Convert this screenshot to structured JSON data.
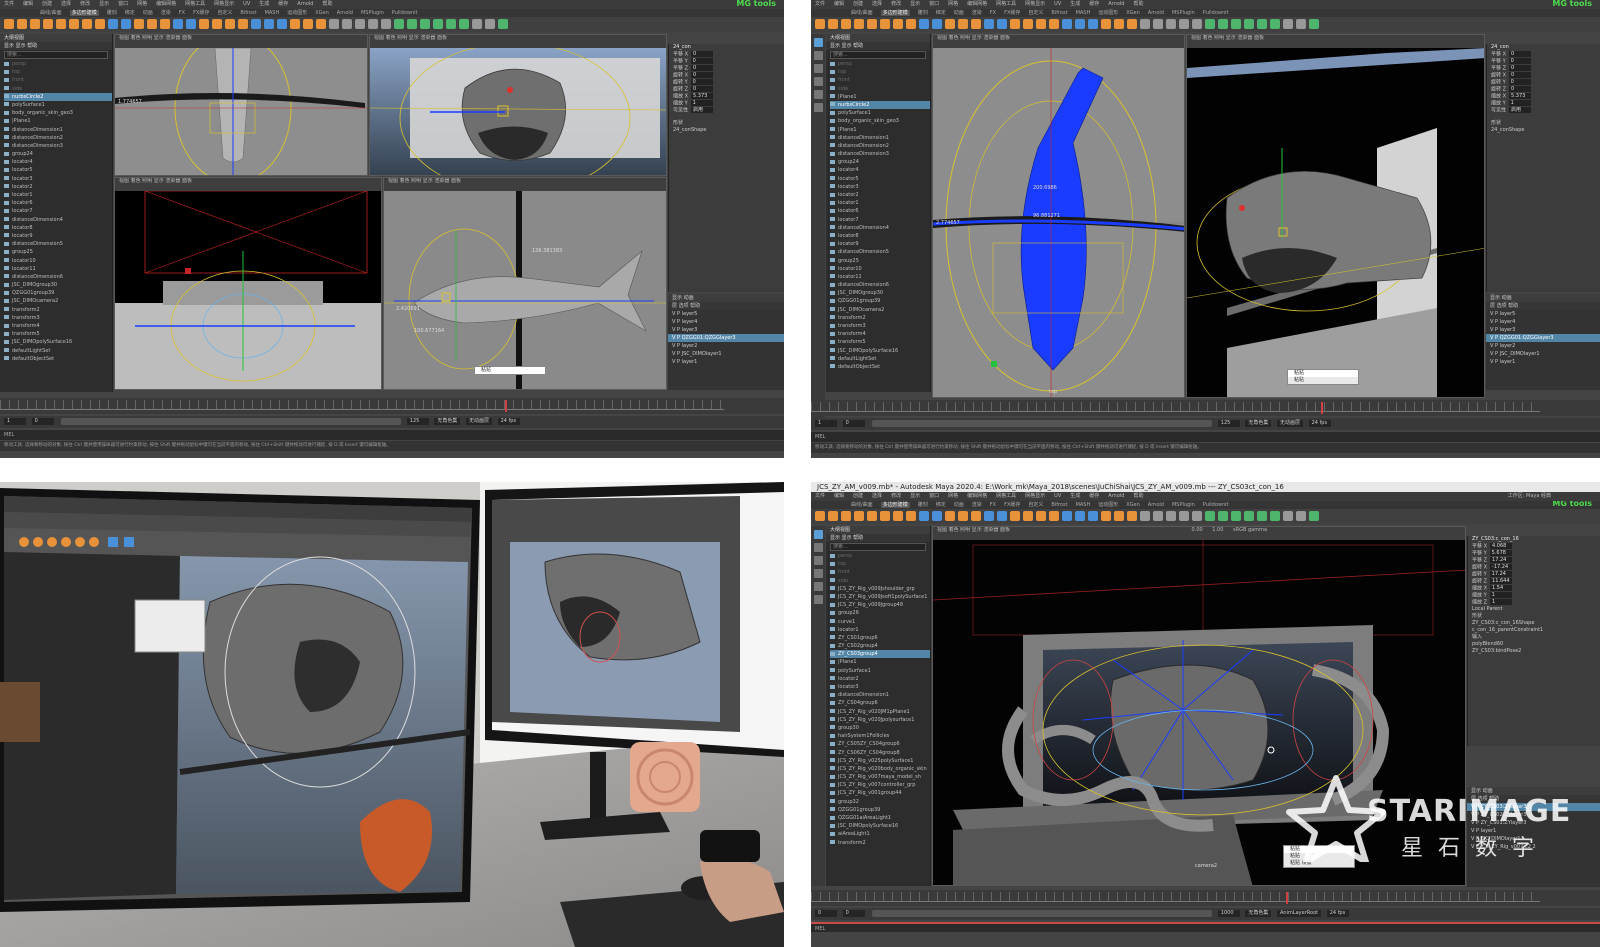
{
  "common": {
    "menu": [
      "文件",
      "编辑",
      "创建",
      "选择",
      "修改",
      "显示",
      "窗口",
      "网格",
      "编辑网格",
      "网格工具",
      "网格显示",
      "UV",
      "生成",
      "缓存",
      "Arnold",
      "帮助"
    ],
    "shelf_tabs": [
      "曲线/曲面",
      "多边形建模",
      "雕刻",
      "绑定",
      "动画",
      "渲染",
      "FX",
      "FX缓存",
      "自定义",
      "Bifrost",
      "MASH",
      "运动图形",
      "XGen",
      "Arnold",
      "MSPlugin",
      "Pulldownit"
    ],
    "shelf_active": "多边形建模",
    "mg_tools": "MG tools",
    "viewport_menu": "视图  着色  照明  显示  渲染器  面板",
    "outliner_title": "大纲视图",
    "outliner_menu": "显示  显示  帮助",
    "search_placeholder": "搜索...",
    "layers_tabs": "显示  动画",
    "layers_menu": "层  选项  帮助",
    "range_start": "0",
    "range_end": "125",
    "fps": "24 fps",
    "no_char": "无角色集",
    "no_anim": "无动画层",
    "mel": "MEL",
    "help_text": "移动工具: 选择要移动的对象, 按住 Ctrl 键并使用操纵器可进行约束移动, 按住 Shift 键并拖动鼠标中键可在当前平面内移动, 按住 Ctrl+Shift 键并拖动可进行捕捉, 按 D 或 Insert 键可编辑枢轴。",
    "popup_items": [
      "粘贴",
      "粘贴",
      "粘贴 设置"
    ]
  },
  "q1": {
    "channel_title": "24_con",
    "channels": [
      {
        "label": "平移 X",
        "value": "0"
      },
      {
        "label": "平移 Y",
        "value": "0"
      },
      {
        "label": "平移 Z",
        "value": "0"
      },
      {
        "label": "旋转 X",
        "value": "0"
      },
      {
        "label": "旋转 Y",
        "value": "0"
      },
      {
        "label": "旋转 Z",
        "value": "0"
      },
      {
        "label": "缩放 X",
        "value": "5.373"
      },
      {
        "label": "缩放 Y",
        "value": "1"
      },
      {
        "label": "可见性",
        "value": "启用"
      }
    ],
    "shape_label": "形状",
    "shape_name": "24_conShape",
    "outliner_items": [
      "persp",
      "top",
      "front",
      "side",
      "nurbsCircle2",
      "polySurface1",
      "body_organic_skin_geo3",
      "|Plane1",
      "distanceDimension1",
      "distanceDimension2",
      "distanceDimension3",
      "group24",
      "locator4",
      "locator5",
      "locator3",
      "locator2",
      "locator1",
      "locator6",
      "locator7",
      "distanceDimension4",
      "locator8",
      "locator9",
      "distanceDimension5",
      "group25",
      "locator10",
      "locator11",
      "distanceDimension6",
      "JSC_DIMOgroup30",
      "QZGG01group39",
      "JSC_DIMOcamera2",
      "transform2",
      "transform3",
      "transform4",
      "transform5",
      "JSC_DIMOpolySurface16",
      "defaultLightSet",
      "defaultObjectSet"
    ],
    "outliner_selected": 4,
    "layers": [
      "layer5",
      "layer4",
      "layer3",
      "QZGG01:QZGGlayer3",
      "layer2",
      "JSC_DIMOlayer1",
      "layer1"
    ],
    "layer_selected": 3,
    "measure_1": "136.381383",
    "measure_2": "100.677164",
    "measure_3": "2.420691",
    "measure_4": "1.774657",
    "current_frame": "97",
    "start_frame": "1",
    "end_frame": "125"
  },
  "q2": {
    "channel_title": "24_con",
    "channels": [
      {
        "label": "平移 X",
        "value": "0"
      },
      {
        "label": "平移 Y",
        "value": "0"
      },
      {
        "label": "平移 Z",
        "value": "0"
      },
      {
        "label": "旋转 X",
        "value": "0"
      },
      {
        "label": "旋转 Y",
        "value": "0"
      },
      {
        "label": "旋转 Z",
        "value": "0"
      },
      {
        "label": "缩放 X",
        "value": "5.373"
      },
      {
        "label": "缩放 Y",
        "value": "1"
      },
      {
        "label": "可见性",
        "value": "启用"
      }
    ],
    "shape_label": "形状",
    "shape_name": "24_conShape",
    "outliner_items": [
      "persp",
      "top",
      "front",
      "side",
      "|Plane1",
      "nurbsCircle2",
      "polySurface1",
      "body_organic_skin_geo3",
      "|Plane1",
      "distanceDimension1",
      "distanceDimension2",
      "distanceDimension3",
      "group24",
      "locator4",
      "locator5",
      "locator3",
      "locator2",
      "locator1",
      "locator6",
      "locator7",
      "distanceDimension4",
      "locator8",
      "locator9",
      "distanceDimension5",
      "group25",
      "locator10",
      "locator11",
      "distanceDimension6",
      "JSC_DIMOgroup30",
      "QZGG01group39",
      "JSC_DIMOcamera2",
      "transform2",
      "transform3",
      "transform4",
      "transform5",
      "JSC_DIMOpolySurface16",
      "defaultLightSet",
      "defaultObjectSet"
    ],
    "outliner_selected": 5,
    "layers": [
      "layer5",
      "layer4",
      "layer3",
      "QZGG01:QZGGlayer3",
      "layer2",
      "JSC_DIMOlayer1",
      "layer1"
    ],
    "layer_selected": 3,
    "measure_1": "200.6986",
    "measure_2": "96.881271",
    "measure_3": "2.774657",
    "current_frame": "97",
    "top_label": "top",
    "start_frame": "1",
    "end_frame": "125"
  },
  "q4": {
    "title": "JCS_ZY_AM_v009.mb* - Autodesk Maya 2020.4: E:\\Work_mk\\Maya_2018\\scenes\\JuChiShai\\JCS_ZY_AM_v009.mb  ---  ZY_CS03ct_con_16",
    "workspace_label": "工作区:  Maya 经典",
    "camera_label": "camera2",
    "gamma": "sRGB gamma",
    "exposure": "0.00",
    "gamma_val": "1.00",
    "channel_title": "ZY_CS03:c_con_16",
    "channels": [
      {
        "label": "平移 X",
        "value": "4.068"
      },
      {
        "label": "平移 Y",
        "value": "5.678"
      },
      {
        "label": "平移 Z",
        "value": "17.24"
      },
      {
        "label": "旋转 X",
        "value": "-17.24"
      },
      {
        "label": "旋转 Y",
        "value": "17.24"
      },
      {
        "label": "旋转 Z",
        "value": "11.644"
      },
      {
        "label": "缩放 X",
        "value": "1.54"
      },
      {
        "label": "缩放 Y",
        "value": "1"
      },
      {
        "label": "缩放 Z",
        "value": "1"
      }
    ],
    "extra": [
      "Local Parent",
      "形状",
      "ZY_CS03:c_con_16Shape",
      "c_con_16_parentConstraint1",
      "输入",
      "polyBlend60",
      "ZY_CS03:bindPose2"
    ],
    "outliner_items": [
      "persp",
      "top",
      "front",
      "side",
      "JCS_ZY_Rig_v009Jshoulder_grp",
      "JCS_ZY_Rig_v009Jsoft1polySurface1",
      "JCS_ZY_Rig_v009Jgroup48",
      "group26",
      "curve1",
      "locator1",
      "ZY_CS01group6",
      "ZY_CS02group4",
      "ZY_CS03group4",
      "|Plane1",
      "polySurface1",
      "locator2",
      "locator3",
      "distanceDimension1",
      "ZY_CS04group6",
      "JCS_ZY_Rig_v020JM1pPlane1",
      "JCS_ZY_Rig_v020Jpolysurface1",
      "group30",
      "hairSystem1Follicles",
      "ZY_CS05ZY_CS04group6",
      "ZY_CS06ZY_CS04group8",
      "JCS_ZY_Rig_v025polySurface1",
      "JCS_ZY_Rig_v020body_organic_skin",
      "JCS_ZY_Rig_v007maya_model_sh",
      "JCS_ZY_Rig_v007controller_grp",
      "JCS_ZY_Rig_v001group44",
      "group32",
      "QZGG01group39",
      "QZGG01aiAreaLight1",
      "JSC_DIMOpolySurface16",
      "aiAreaLight1",
      "transform2"
    ],
    "outliner_selected": 12,
    "layers": [
      "ZY_CS03:ZYlayer3",
      "ZY_CS02:ZYlayer3",
      "ZY_CS01:ZYlayer3",
      "layer1",
      "JSC_DIMOlayer1",
      "JCS_ZY_Rig_v007:c2 2"
    ],
    "layer_selected": 0,
    "current_frame": "652",
    "end_frame": "1000",
    "start_frame": "0",
    "anim_layer": "AnimLayerRoot",
    "fps": "24 fps"
  },
  "watermark": {
    "en": "STARIMAGE",
    "zh": "星 石 数 字"
  },
  "colors": {
    "maya_bg": "#444444",
    "outliner_sel": "#5285a6",
    "mg_green": "#4ddb4d",
    "wire_blue": "#1a3cff",
    "wire_yellow": "#d8c22e"
  }
}
